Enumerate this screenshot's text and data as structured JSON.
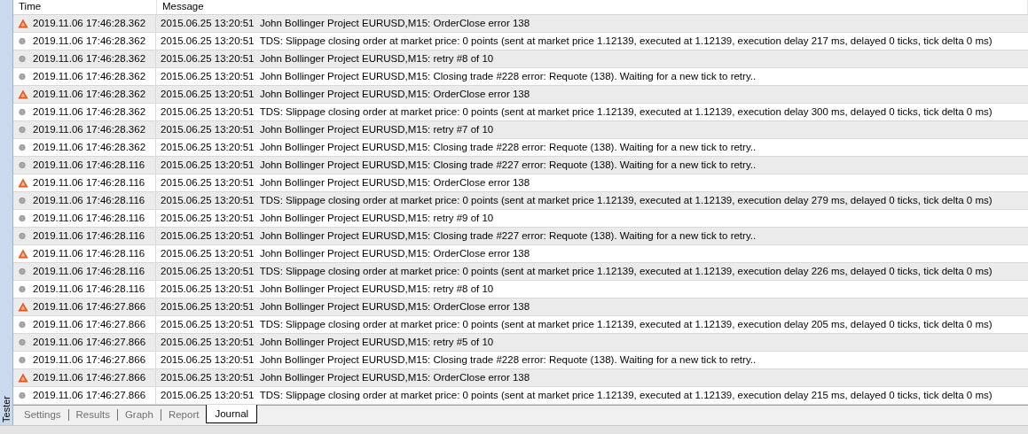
{
  "side_label": "Tester",
  "table": {
    "columns": [
      "Time",
      "Message"
    ],
    "rows": [
      {
        "kind": "warning",
        "time": "2019.11.06 17:46:28.362",
        "message": "2015.06.25 13:20:51  John Bollinger Project EURUSD,M15: OrderClose error 138"
      },
      {
        "kind": "info",
        "time": "2019.11.06 17:46:28.362",
        "message": "2015.06.25 13:20:51  TDS: Slippage closing order at market price: 0 points (sent at market price 1.12139, executed at 1.12139, execution delay 217 ms, delayed 0 ticks, tick delta 0 ms)"
      },
      {
        "kind": "info",
        "time": "2019.11.06 17:46:28.362",
        "message": "2015.06.25 13:20:51  John Bollinger Project EURUSD,M15: retry #8 of 10"
      },
      {
        "kind": "info",
        "time": "2019.11.06 17:46:28.362",
        "message": "2015.06.25 13:20:51  John Bollinger Project EURUSD,M15: Closing trade #228 error: Requote (138). Waiting for a new tick to retry.."
      },
      {
        "kind": "warning",
        "time": "2019.11.06 17:46:28.362",
        "message": "2015.06.25 13:20:51  John Bollinger Project EURUSD,M15: OrderClose error 138"
      },
      {
        "kind": "info",
        "time": "2019.11.06 17:46:28.362",
        "message": "2015.06.25 13:20:51  TDS: Slippage closing order at market price: 0 points (sent at market price 1.12139, executed at 1.12139, execution delay 300 ms, delayed 0 ticks, tick delta 0 ms)"
      },
      {
        "kind": "info",
        "time": "2019.11.06 17:46:28.362",
        "message": "2015.06.25 13:20:51  John Bollinger Project EURUSD,M15: retry #7 of 10"
      },
      {
        "kind": "info",
        "time": "2019.11.06 17:46:28.362",
        "message": "2015.06.25 13:20:51  John Bollinger Project EURUSD,M15: Closing trade #228 error: Requote (138). Waiting for a new tick to retry.."
      },
      {
        "kind": "info",
        "time": "2019.11.06 17:46:28.116",
        "message": "2015.06.25 13:20:51  John Bollinger Project EURUSD,M15: Closing trade #227 error: Requote (138). Waiting for a new tick to retry.."
      },
      {
        "kind": "warning",
        "time": "2019.11.06 17:46:28.116",
        "message": "2015.06.25 13:20:51  John Bollinger Project EURUSD,M15: OrderClose error 138"
      },
      {
        "kind": "info",
        "time": "2019.11.06 17:46:28.116",
        "message": "2015.06.25 13:20:51  TDS: Slippage closing order at market price: 0 points (sent at market price 1.12139, executed at 1.12139, execution delay 279 ms, delayed 0 ticks, tick delta 0 ms)"
      },
      {
        "kind": "info",
        "time": "2019.11.06 17:46:28.116",
        "message": "2015.06.25 13:20:51  John Bollinger Project EURUSD,M15: retry #9 of 10"
      },
      {
        "kind": "info",
        "time": "2019.11.06 17:46:28.116",
        "message": "2015.06.25 13:20:51  John Bollinger Project EURUSD,M15: Closing trade #227 error: Requote (138). Waiting for a new tick to retry.."
      },
      {
        "kind": "warning",
        "time": "2019.11.06 17:46:28.116",
        "message": "2015.06.25 13:20:51  John Bollinger Project EURUSD,M15: OrderClose error 138"
      },
      {
        "kind": "info",
        "time": "2019.11.06 17:46:28.116",
        "message": "2015.06.25 13:20:51  TDS: Slippage closing order at market price: 0 points (sent at market price 1.12139, executed at 1.12139, execution delay 226 ms, delayed 0 ticks, tick delta 0 ms)"
      },
      {
        "kind": "info",
        "time": "2019.11.06 17:46:28.116",
        "message": "2015.06.25 13:20:51  John Bollinger Project EURUSD,M15: retry #8 of 10"
      },
      {
        "kind": "warning",
        "time": "2019.11.06 17:46:27.866",
        "message": "2015.06.25 13:20:51  John Bollinger Project EURUSD,M15: OrderClose error 138"
      },
      {
        "kind": "info",
        "time": "2019.11.06 17:46:27.866",
        "message": "2015.06.25 13:20:51  TDS: Slippage closing order at market price: 0 points (sent at market price 1.12139, executed at 1.12139, execution delay 205 ms, delayed 0 ticks, tick delta 0 ms)"
      },
      {
        "kind": "info",
        "time": "2019.11.06 17:46:27.866",
        "message": "2015.06.25 13:20:51  John Bollinger Project EURUSD,M15: retry #5 of 10"
      },
      {
        "kind": "info",
        "time": "2019.11.06 17:46:27.866",
        "message": "2015.06.25 13:20:51  John Bollinger Project EURUSD,M15: Closing trade #228 error: Requote (138). Waiting for a new tick to retry.."
      },
      {
        "kind": "warning",
        "time": "2019.11.06 17:46:27.866",
        "message": "2015.06.25 13:20:51  John Bollinger Project EURUSD,M15: OrderClose error 138"
      },
      {
        "kind": "info",
        "time": "2019.11.06 17:46:27.866",
        "message": "2015.06.25 13:20:51  TDS: Slippage closing order at market price: 0 points (sent at market price 1.12139, executed at 1.12139, execution delay 215 ms, delayed 0 ticks, tick delta 0 ms)"
      }
    ]
  },
  "tabs": [
    {
      "label": "Settings",
      "selected": false
    },
    {
      "label": "Results",
      "selected": false
    },
    {
      "label": "Graph",
      "selected": false
    },
    {
      "label": "Report",
      "selected": false
    },
    {
      "label": "Journal",
      "selected": true
    }
  ]
}
